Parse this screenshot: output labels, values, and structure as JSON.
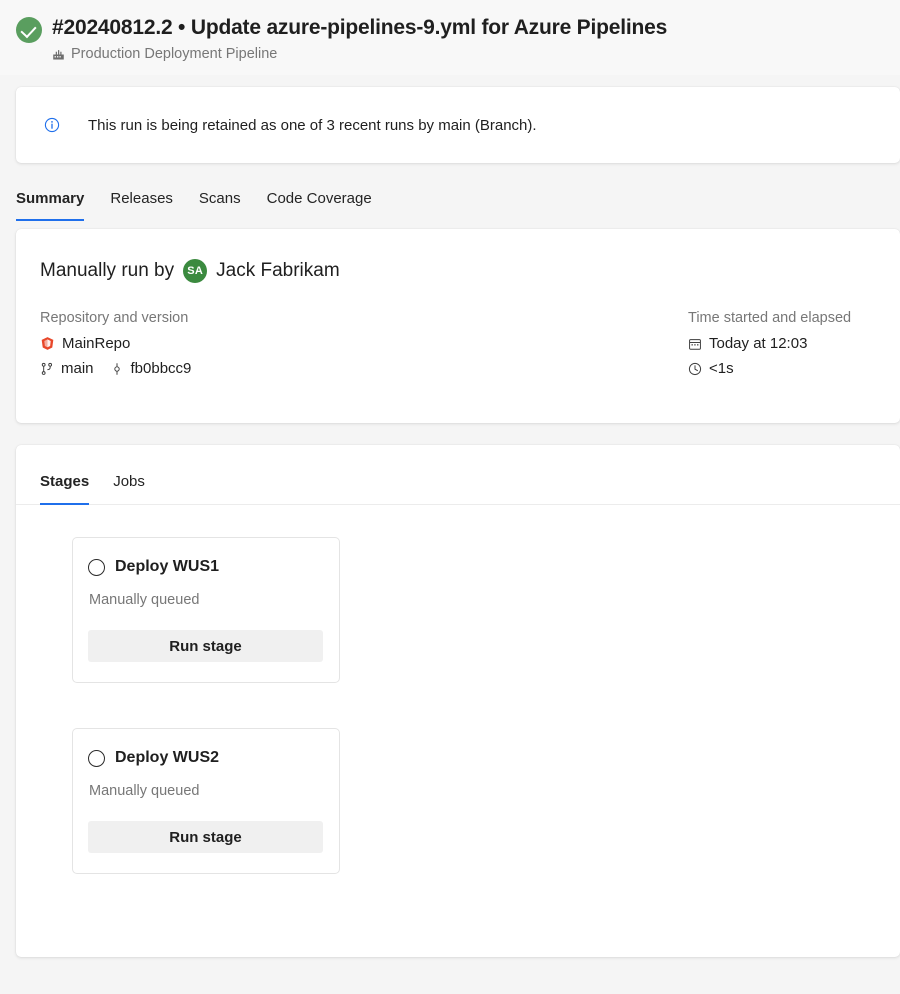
{
  "header": {
    "status_icon": "check-circle-icon",
    "status_color": "#5a9e5f",
    "run_title": "#20240812.2 • Update azure-pipelines-9.yml for Azure Pipelines",
    "pipeline_icon": "pipeline-icon",
    "pipeline_name": "Production Deployment Pipeline"
  },
  "banner": {
    "icon": "info-circle-icon",
    "icon_color": "#1f6feb",
    "message": "This run is being retained as one of 3 recent runs by main (Branch)."
  },
  "tabs": [
    {
      "label": "Summary",
      "active": true
    },
    {
      "label": "Releases",
      "active": false
    },
    {
      "label": "Scans",
      "active": false
    },
    {
      "label": "Code Coverage",
      "active": false
    }
  ],
  "summary": {
    "run_by_prefix": "Manually run by",
    "avatar_initials": "SA",
    "avatar_color": "#3b8a3f",
    "user_name": "Jack Fabrikam",
    "repository": {
      "heading": "Repository and version",
      "repo_icon": "azure-repos-icon",
      "repo_name": "MainRepo",
      "branch_icon": "branch-icon",
      "branch_name": "main",
      "commit_icon": "commit-icon",
      "commit_sha": "fb0bbcc9"
    },
    "time": {
      "heading": "Time started and elapsed",
      "calendar_icon": "calendar-icon",
      "started": "Today at 12:03",
      "clock_icon": "clock-icon",
      "elapsed": "<1s"
    }
  },
  "stages_section": {
    "subtabs": [
      {
        "label": "Stages",
        "active": true
      },
      {
        "label": "Jobs",
        "active": false
      }
    ],
    "stages": [
      {
        "status_icon": "pending-circle-icon",
        "name": "Deploy WUS1",
        "status_text": "Manually queued",
        "action_label": "Run stage"
      },
      {
        "status_icon": "pending-circle-icon",
        "name": "Deploy WUS2",
        "status_text": "Manually queued",
        "action_label": "Run stage"
      }
    ]
  },
  "theme": {
    "accent": "#1f6feb",
    "page_bg": "#f5f5f5",
    "card_bg": "#ffffff",
    "muted_text": "#777777"
  }
}
